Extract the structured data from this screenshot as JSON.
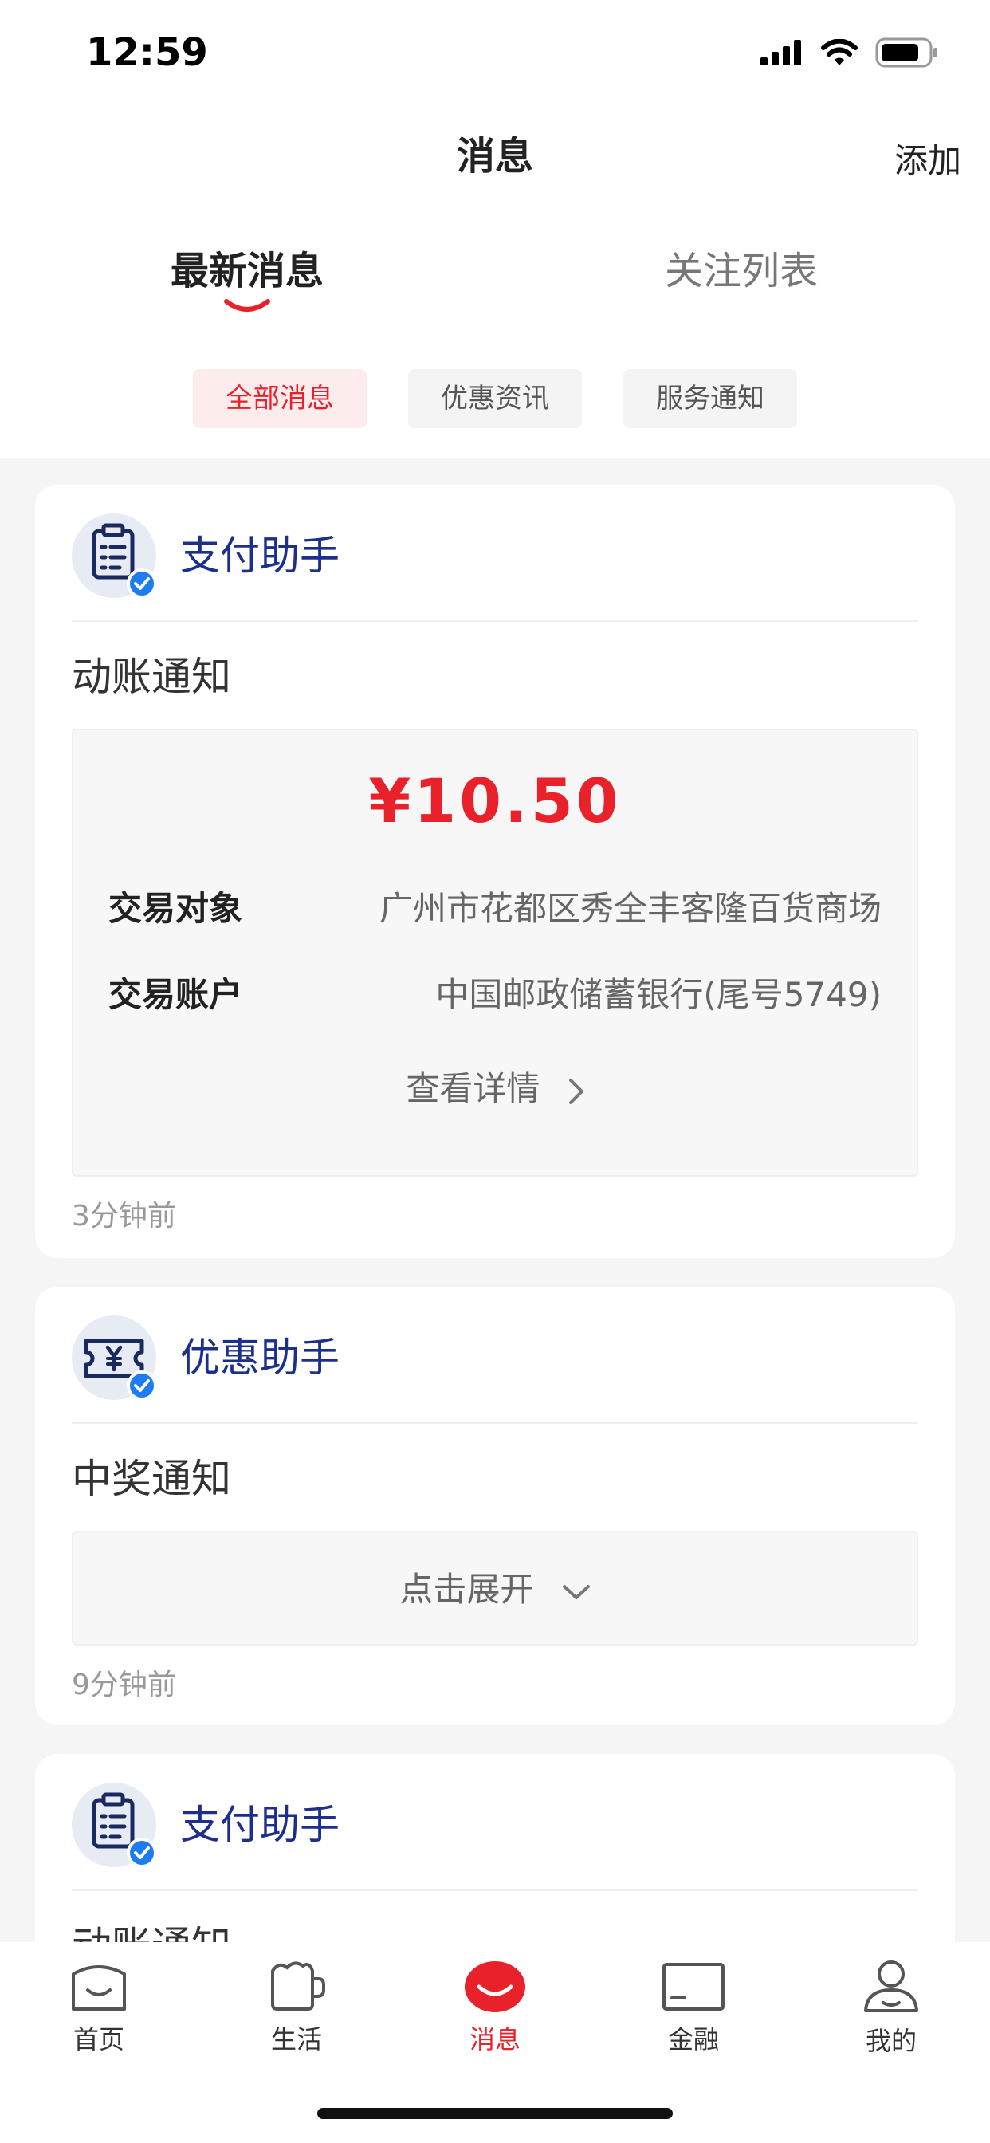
{
  "status_bar": {
    "time": "12:59"
  },
  "nav": {
    "title": "消息",
    "add_label": "添加"
  },
  "main_tabs": [
    {
      "label": "最新消息",
      "active": true
    },
    {
      "label": "关注列表",
      "active": false
    }
  ],
  "filters": [
    {
      "label": "全部消息",
      "active": true
    },
    {
      "label": "优惠资讯",
      "active": false
    },
    {
      "label": "服务通知",
      "active": false
    }
  ],
  "messages": [
    {
      "sender": "支付助手",
      "icon": "clipboard-list-icon",
      "subject": "动账通知",
      "amount": "¥10.50",
      "fields": [
        {
          "label": "交易对象",
          "value": "广州市花都区秀全丰客隆百货商场"
        },
        {
          "label": "交易账户",
          "value": "中国邮政储蓄银行(尾号5749)"
        }
      ],
      "detail_label": "查看详情",
      "time": "3分钟前"
    },
    {
      "sender": "优惠助手",
      "icon": "coupon-yen-icon",
      "subject": "中奖通知",
      "expand_label": "点击展开",
      "time": "9分钟前"
    },
    {
      "sender": "支付助手",
      "icon": "clipboard-list-icon",
      "subject": "动账通知"
    }
  ],
  "tabbar": [
    {
      "label": "首页",
      "icon": "home-icon",
      "active": false
    },
    {
      "label": "生活",
      "icon": "cup-icon",
      "active": false
    },
    {
      "label": "消息",
      "icon": "message-smile-icon",
      "active": true
    },
    {
      "label": "金融",
      "icon": "card-icon",
      "active": false
    },
    {
      "label": "我的",
      "icon": "profile-icon",
      "active": false
    }
  ],
  "colors": {
    "accent_red": "#e8212b",
    "sender_blue": "#1c2f8c",
    "verified_blue": "#1e7cf2"
  }
}
